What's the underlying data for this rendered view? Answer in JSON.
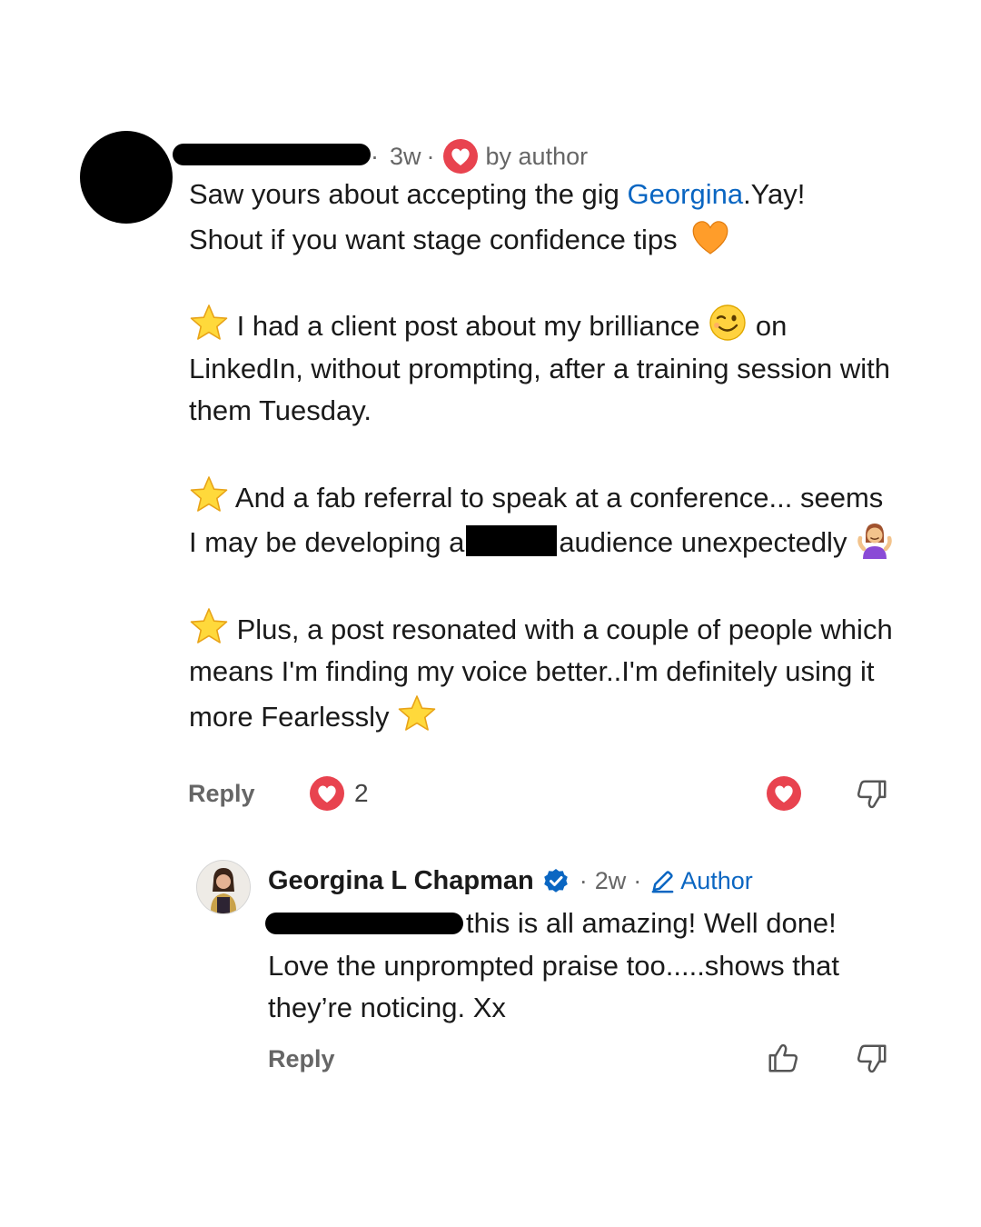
{
  "comment": {
    "time": "3w",
    "dot": "·",
    "liked_badge": "by author",
    "line1_pre": "Saw yours about accepting the gig ",
    "line1_mention": "Georgina",
    "line1_post": ".Yay!",
    "line2": "Shout if you want stage confidence tips",
    "p2_pre": " I had a client post about my brilliance ",
    "p2_post": " on LinkedIn, without prompting, after a training session with them Tuesday.",
    "p3_pre": " And a fab referral to speak at a conference... seems I may be developing a",
    "p3_post": "audience unexpectedly ",
    "p4": " Plus, a post resonated with a couple of people which means I'm finding my voice better..I'm definitely using it more Fearlessly ",
    "reply_label": "Reply",
    "reaction_count": "2"
  },
  "reply": {
    "author": "Georgina L Chapman",
    "time": "2w",
    "dot": "·",
    "author_tag": "Author",
    "text_first": "this is all amazing! Well done!",
    "text_rest": "Love the unprompted praise too.....shows that they’re noticing. Xx",
    "reply_label": "Reply"
  },
  "icons": {
    "heart_badge": "heart-icon",
    "orange_heart": "orange-heart-emoji",
    "star": "star-emoji",
    "wink": "winking-face-emoji",
    "shrug": "shrugging-person-emoji",
    "thumbs_up": "thumbs-up-icon",
    "thumbs_down": "thumbs-down-icon",
    "verified": "verified-badge-icon",
    "pencil": "pencil-icon"
  },
  "colors": {
    "link": "#0a66c2",
    "heart": "#e8434f",
    "muted": "#666666"
  }
}
